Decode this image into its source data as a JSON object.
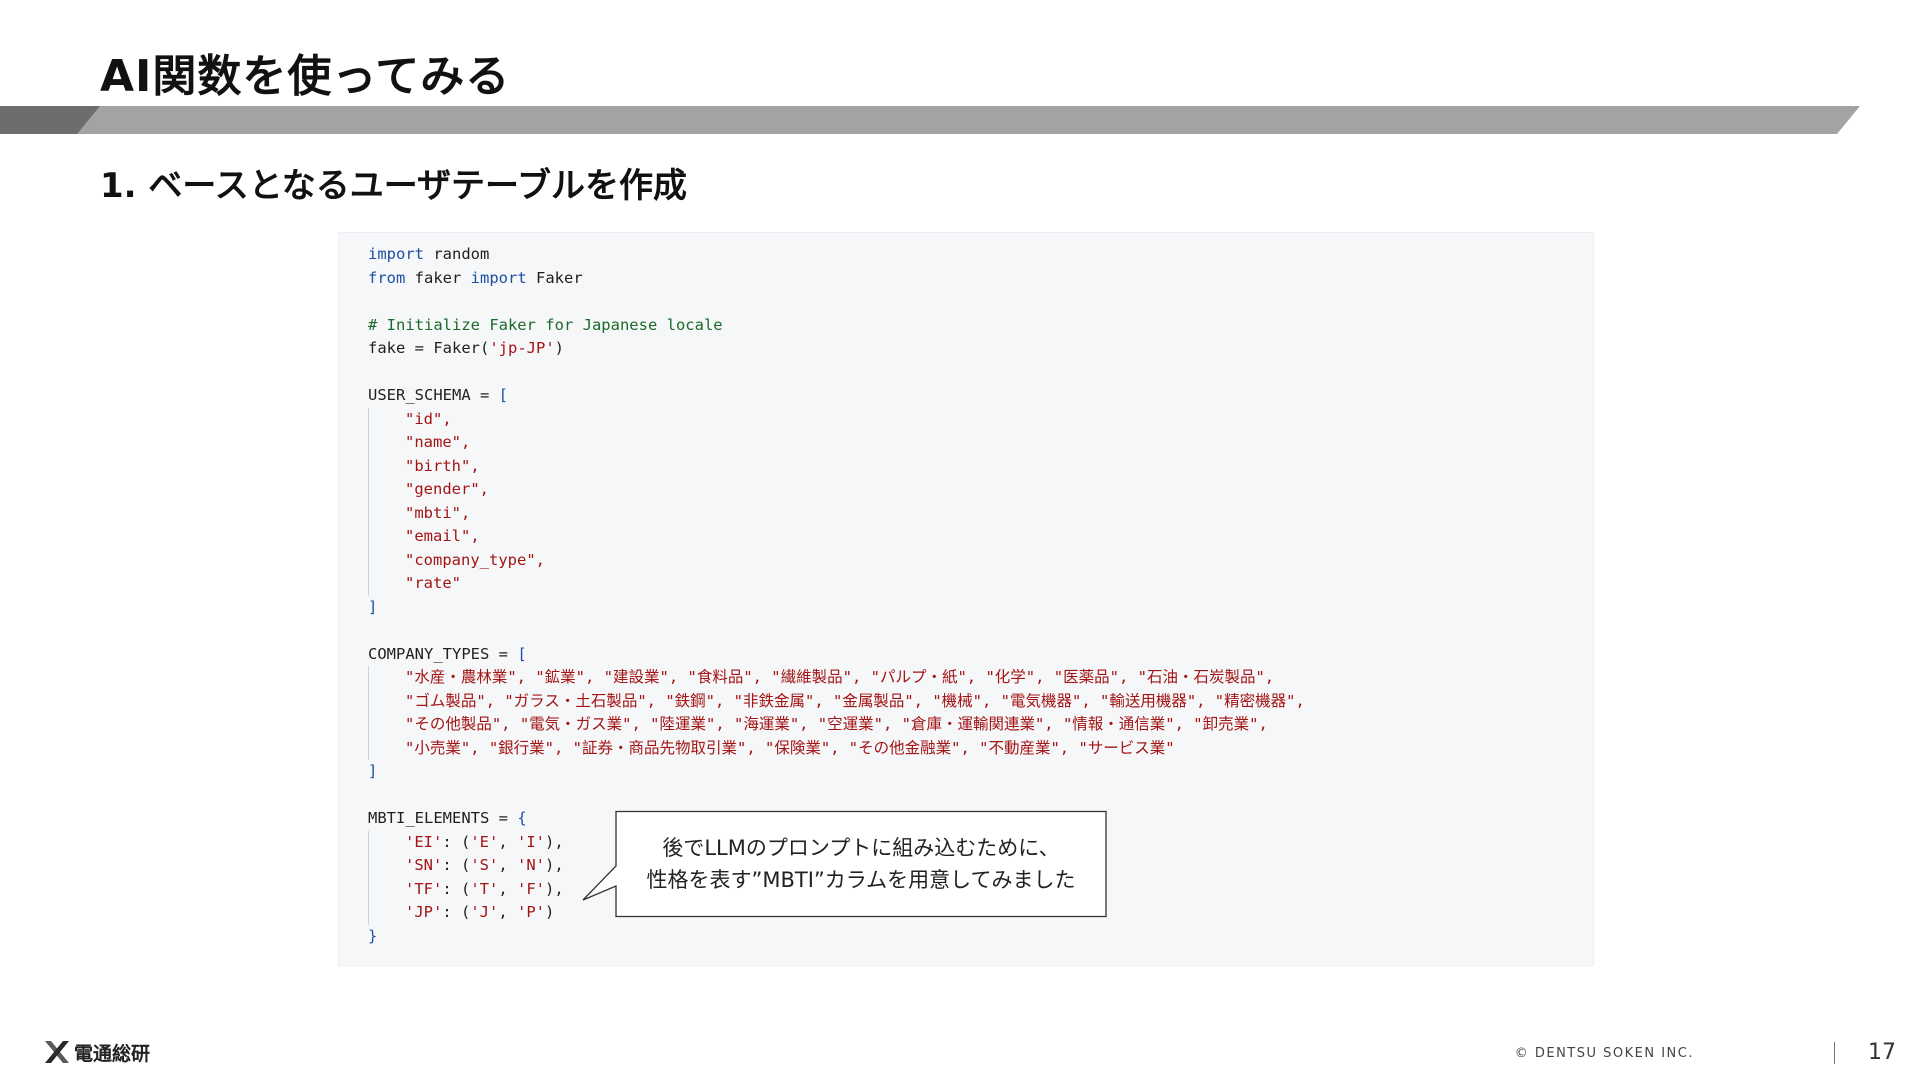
{
  "slide": {
    "title": "AI関数を使ってみる",
    "subtitle": "1. ベースとなるユーザテーブルを作成"
  },
  "code": {
    "import_kw": "import",
    "random": " random",
    "from_kw": "from",
    "faker_mod": " faker ",
    "faker_cls": " Faker",
    "comment": "# Initialize Faker for Japanese locale",
    "fake_assign": "fake = Faker(",
    "locale": "'jp-JP'",
    "close_paren": ")",
    "user_schema_decl": "USER_SCHEMA = ",
    "user_schema_items": [
      "\"id\",",
      "\"name\",",
      "\"birth\",",
      "\"gender\",",
      "\"mbti\",",
      "\"email\",",
      "\"company_type\",",
      "\"rate\""
    ],
    "company_types_decl": "COMPANY_TYPES = ",
    "company_types_lines": [
      "\"水産・農林業\", \"鉱業\", \"建設業\", \"食料品\", \"繊維製品\", \"パルプ・紙\", \"化学\", \"医薬品\", \"石油・石炭製品\",",
      "\"ゴム製品\", \"ガラス・土石製品\", \"鉄鋼\", \"非鉄金属\", \"金属製品\", \"機械\", \"電気機器\", \"輸送用機器\", \"精密機器\",",
      "\"その他製品\", \"電気・ガス業\", \"陸運業\", \"海運業\", \"空運業\", \"倉庫・運輸関連業\", \"情報・通信業\", \"卸売業\",",
      "\"小売業\", \"銀行業\", \"証券・商品先物取引業\", \"保険業\", \"その他金融業\", \"不動産業\", \"サービス業\""
    ],
    "mbti_decl": "MBTI_ELEMENTS = ",
    "mbti_lines": [
      {
        "key": "'EI'",
        "a": "'E'",
        "b": "'I'",
        "end": "),"
      },
      {
        "key": "'SN'",
        "a": "'S'",
        "b": "'N'",
        "end": "),"
      },
      {
        "key": "'TF'",
        "a": "'T'",
        "b": "'F'",
        "end": "),"
      },
      {
        "key": "'JP'",
        "a": "'J'",
        "b": "'P'",
        "end": ")"
      }
    ],
    "open_bracket": "[",
    "close_bracket": "]",
    "open_brace": "{",
    "close_brace": "}"
  },
  "callout": {
    "line1": "後でLLMのプロンプトに組み込むために、",
    "line2": "性格を表す”MBTI”カラムを用意してみました"
  },
  "footer": {
    "logo_text": "電通総研",
    "copyright": "© DENTSU SOKEN INC.",
    "page_number": "17"
  },
  "colors": {
    "keyword": "#1f4fa0",
    "comment": "#1c6a28",
    "string": "#a31515",
    "code_background": "#f6f7f9",
    "title_bar": "#a3a3a3",
    "title_bar_dark": "#6d6d6d"
  }
}
